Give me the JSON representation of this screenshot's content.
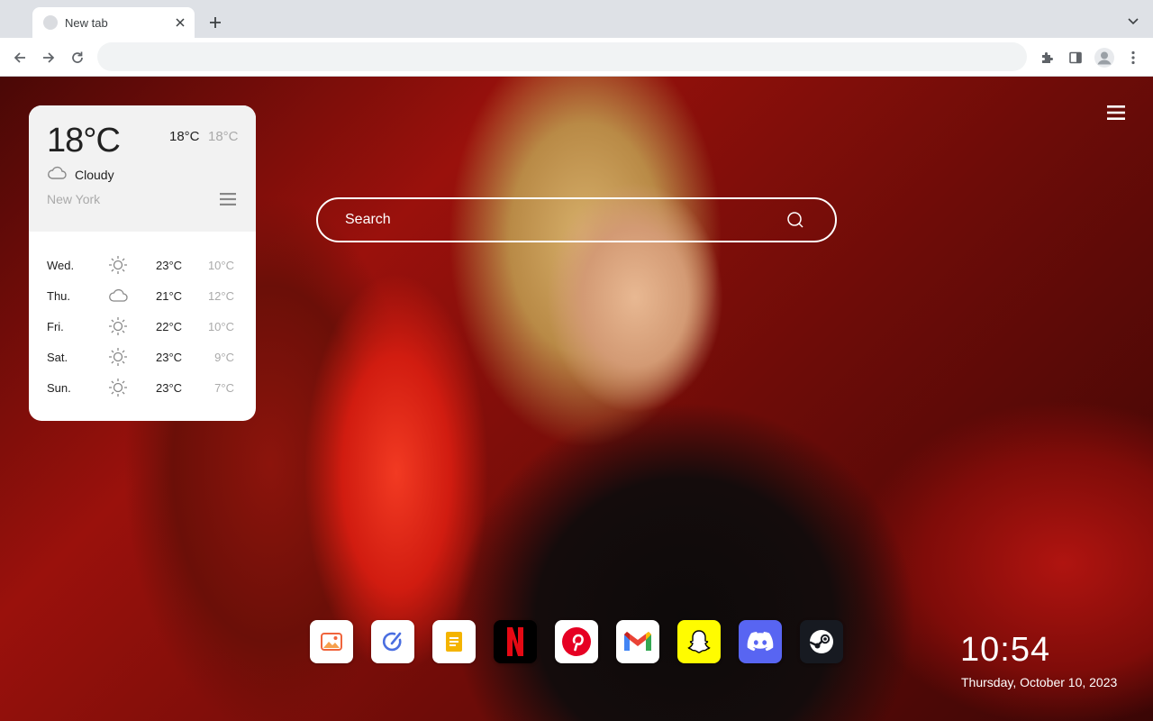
{
  "browser": {
    "tab_title": "New tab",
    "omnibox_value": ""
  },
  "weather": {
    "current_temp": "18°C",
    "high": "18°C",
    "low": "18°C",
    "condition": "Cloudy",
    "condition_icon": "cloud-icon",
    "city": "New York",
    "forecast": [
      {
        "day": "Wed.",
        "icon": "sun-icon",
        "high": "23°C",
        "low": "10°C"
      },
      {
        "day": "Thu.",
        "icon": "cloud-icon",
        "high": "21°C",
        "low": "12°C"
      },
      {
        "day": "Fri.",
        "icon": "sun-icon",
        "high": "22°C",
        "low": "10°C"
      },
      {
        "day": "Sat.",
        "icon": "sun-icon",
        "high": "23°C",
        "low": "9°C"
      },
      {
        "day": "Sun.",
        "icon": "sun-icon",
        "high": "23°C",
        "low": "7°C"
      }
    ]
  },
  "search": {
    "placeholder": "Search"
  },
  "shortcuts": [
    {
      "name": "gallery",
      "icon": "image-icon"
    },
    {
      "name": "pen",
      "icon": "pen-circle-icon"
    },
    {
      "name": "notes",
      "icon": "notes-icon"
    },
    {
      "name": "netflix",
      "icon": "netflix-icon"
    },
    {
      "name": "pinterest",
      "icon": "pinterest-icon"
    },
    {
      "name": "gmail",
      "icon": "gmail-icon"
    },
    {
      "name": "snapchat",
      "icon": "snapchat-icon"
    },
    {
      "name": "discord",
      "icon": "discord-icon"
    },
    {
      "name": "steam",
      "icon": "steam-icon"
    }
  ],
  "clock": {
    "time": "10:54",
    "date": "Thursday, October 10, 2023"
  },
  "colors": {
    "netflix": "#e50914",
    "pinterest": "#e60023",
    "snapchat": "#fffc00",
    "discord": "#5865f2",
    "steam": "#171a21",
    "notes": "#f4b400"
  }
}
